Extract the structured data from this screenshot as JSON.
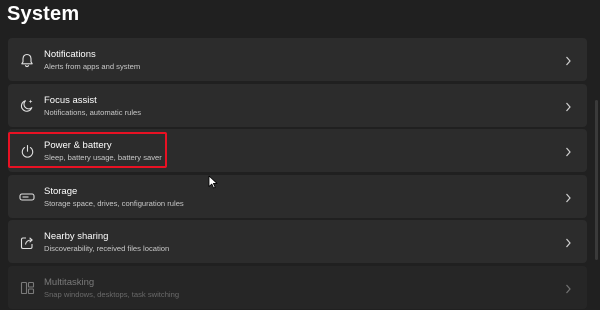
{
  "page": {
    "title": "System"
  },
  "items": [
    {
      "icon": "bell-icon",
      "title": "Notifications",
      "subtitle": "Alerts from apps and system"
    },
    {
      "icon": "focus-assist-icon",
      "title": "Focus assist",
      "subtitle": "Notifications, automatic rules"
    },
    {
      "icon": "power-icon",
      "title": "Power & battery",
      "subtitle": "Sleep, battery usage, battery saver"
    },
    {
      "icon": "storage-icon",
      "title": "Storage",
      "subtitle": "Storage space, drives, configuration rules"
    },
    {
      "icon": "share-icon",
      "title": "Nearby sharing",
      "subtitle": "Discoverability, received files location"
    },
    {
      "icon": "multitasking-icon",
      "title": "Multitasking",
      "subtitle": "Snap windows, desktops, task switching"
    }
  ],
  "colors": {
    "background": "#202020",
    "card": "#2c2c2c",
    "highlight": "#e81123"
  }
}
